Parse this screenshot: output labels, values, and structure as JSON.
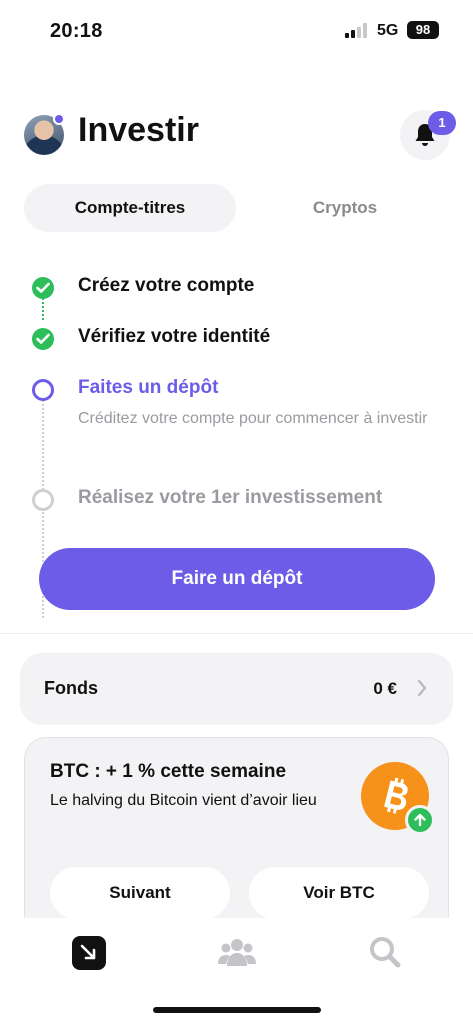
{
  "status_bar": {
    "time": "20:18",
    "network": "5G",
    "battery": "98",
    "icons": [
      "signal-icon",
      "battery-icon"
    ]
  },
  "header": {
    "title": "Investir",
    "notification_count": "1",
    "icons": [
      "avatar",
      "bell-icon"
    ]
  },
  "tabs": [
    {
      "label": "Compte-titres",
      "active": true
    },
    {
      "label": "Cryptos",
      "active": false
    }
  ],
  "steps": [
    {
      "title": "Créez votre compte",
      "state": "done"
    },
    {
      "title": "Vérifiez votre identité",
      "state": "done"
    },
    {
      "title": "Faites un dépôt",
      "state": "current",
      "description": "Créditez votre compte pour commencer à investir"
    },
    {
      "title": "Réalisez votre 1er investissement",
      "state": "pending"
    }
  ],
  "cta": {
    "label": "Faire un dépôt"
  },
  "funds": {
    "label": "Fonds",
    "value": "0 €"
  },
  "btc_card": {
    "title": "BTC : + 1 % cette semaine",
    "description": "Le halving du Bitcoin vient d’avoir lieu",
    "next_label": "Suivant",
    "view_label": "Voir BTC",
    "icons": [
      "bitcoin-icon",
      "arrow-up-icon"
    ]
  },
  "tab_bar": {
    "items": [
      "invest-icon",
      "community-icon",
      "search-icon"
    ]
  },
  "colors": {
    "accent": "#6c5ce7",
    "success": "#2dbd5a",
    "bitcoin": "#f6921a",
    "muted": "#9a9aa0"
  }
}
